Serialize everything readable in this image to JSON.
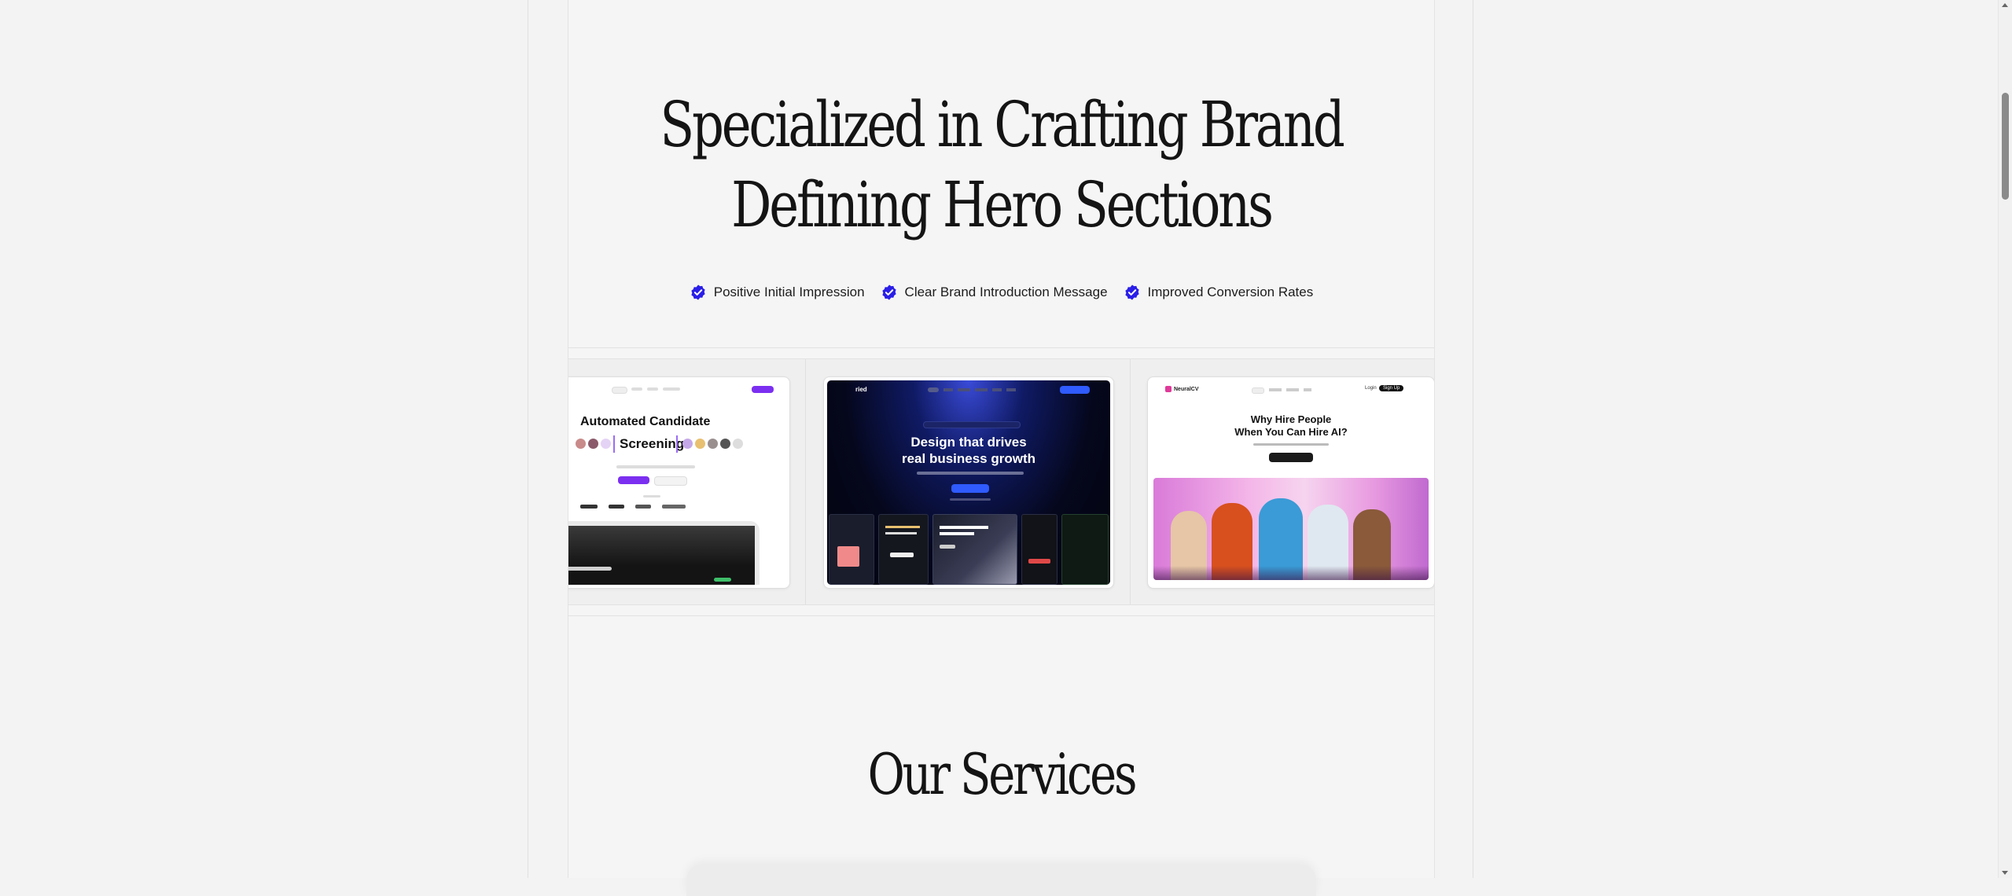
{
  "hero": {
    "title_line1": "Specialized in Crafting Brand",
    "title_line2": "Defining Hero Sections"
  },
  "features": [
    {
      "icon": "verified-check-icon",
      "label": "Positive Initial Impression"
    },
    {
      "icon": "verified-check-icon",
      "label": "Clear Brand Introduction Message"
    },
    {
      "icon": "verified-check-icon",
      "label": "Improved Conversion Rates"
    }
  ],
  "gallery": {
    "card1": {
      "headline_line1": "Automated Candidate",
      "headline_line2": "Screening"
    },
    "card2": {
      "brand": "ried",
      "headline_line1": "Design that drives",
      "headline_line2": "real business growth"
    },
    "card3": {
      "brand": "NeuralCV",
      "login": "Login",
      "signup": "Sign Up",
      "headline_line1": "Why Hire People",
      "headline_line2": "When You Can Hire AI?"
    }
  },
  "services": {
    "title": "Our Services"
  },
  "colors": {
    "accent_check": "#2a1ee8",
    "purple_cta": "#7b2ff0",
    "blue_cta": "#2f5bff",
    "page_bg": "#f3f3f3"
  }
}
